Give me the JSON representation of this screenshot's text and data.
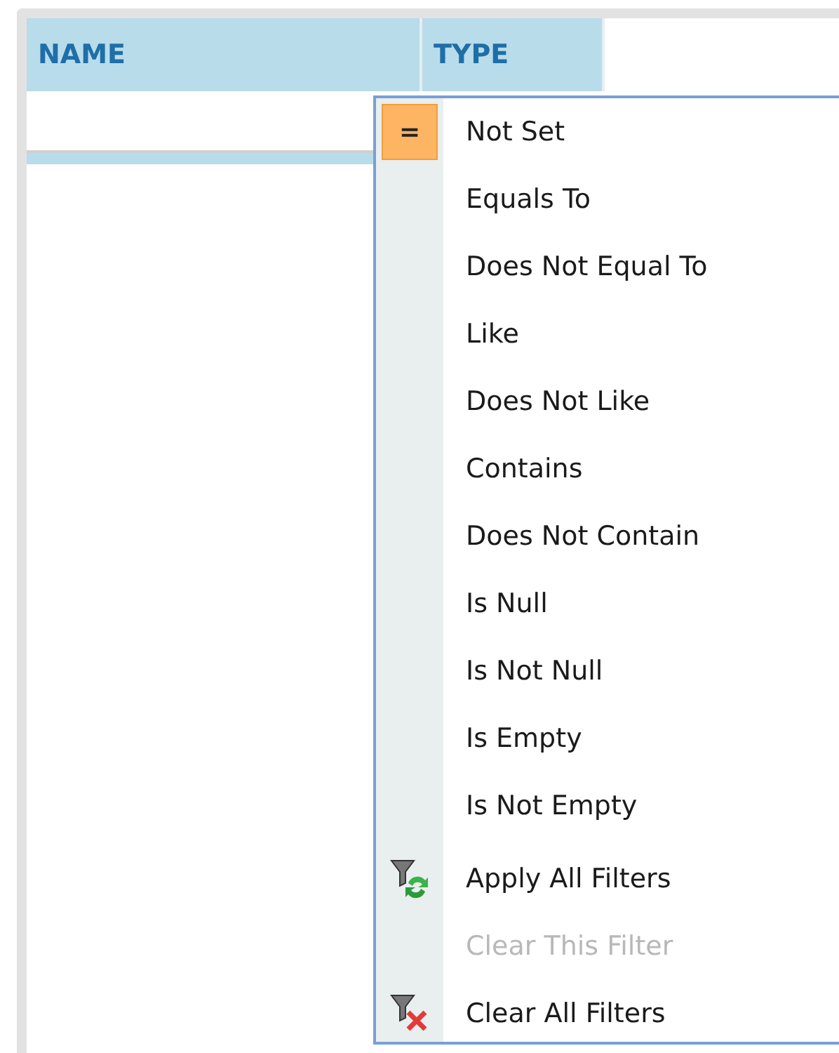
{
  "grid": {
    "columns": [
      {
        "label": "NAME"
      },
      {
        "label": "TYPE"
      }
    ]
  },
  "filter_menu": {
    "operators": [
      {
        "label": "Not Set",
        "selected": true,
        "glyph": "="
      },
      {
        "label": "Equals To",
        "selected": false
      },
      {
        "label": "Does Not Equal To",
        "selected": false
      },
      {
        "label": "Like",
        "selected": false
      },
      {
        "label": "Does Not Like",
        "selected": false
      },
      {
        "label": "Contains",
        "selected": false
      },
      {
        "label": "Does Not Contain",
        "selected": false
      },
      {
        "label": "Is Null",
        "selected": false
      },
      {
        "label": "Is Not Null",
        "selected": false
      },
      {
        "label": "Is Empty",
        "selected": false
      },
      {
        "label": "Is Not Empty",
        "selected": false
      }
    ],
    "actions": [
      {
        "label": "Apply All Filters",
        "disabled": false,
        "kind": "apply"
      },
      {
        "label": "Clear This Filter",
        "disabled": true,
        "kind": "plain"
      },
      {
        "label": "Clear All Filters",
        "disabled": false,
        "kind": "clear"
      }
    ]
  }
}
